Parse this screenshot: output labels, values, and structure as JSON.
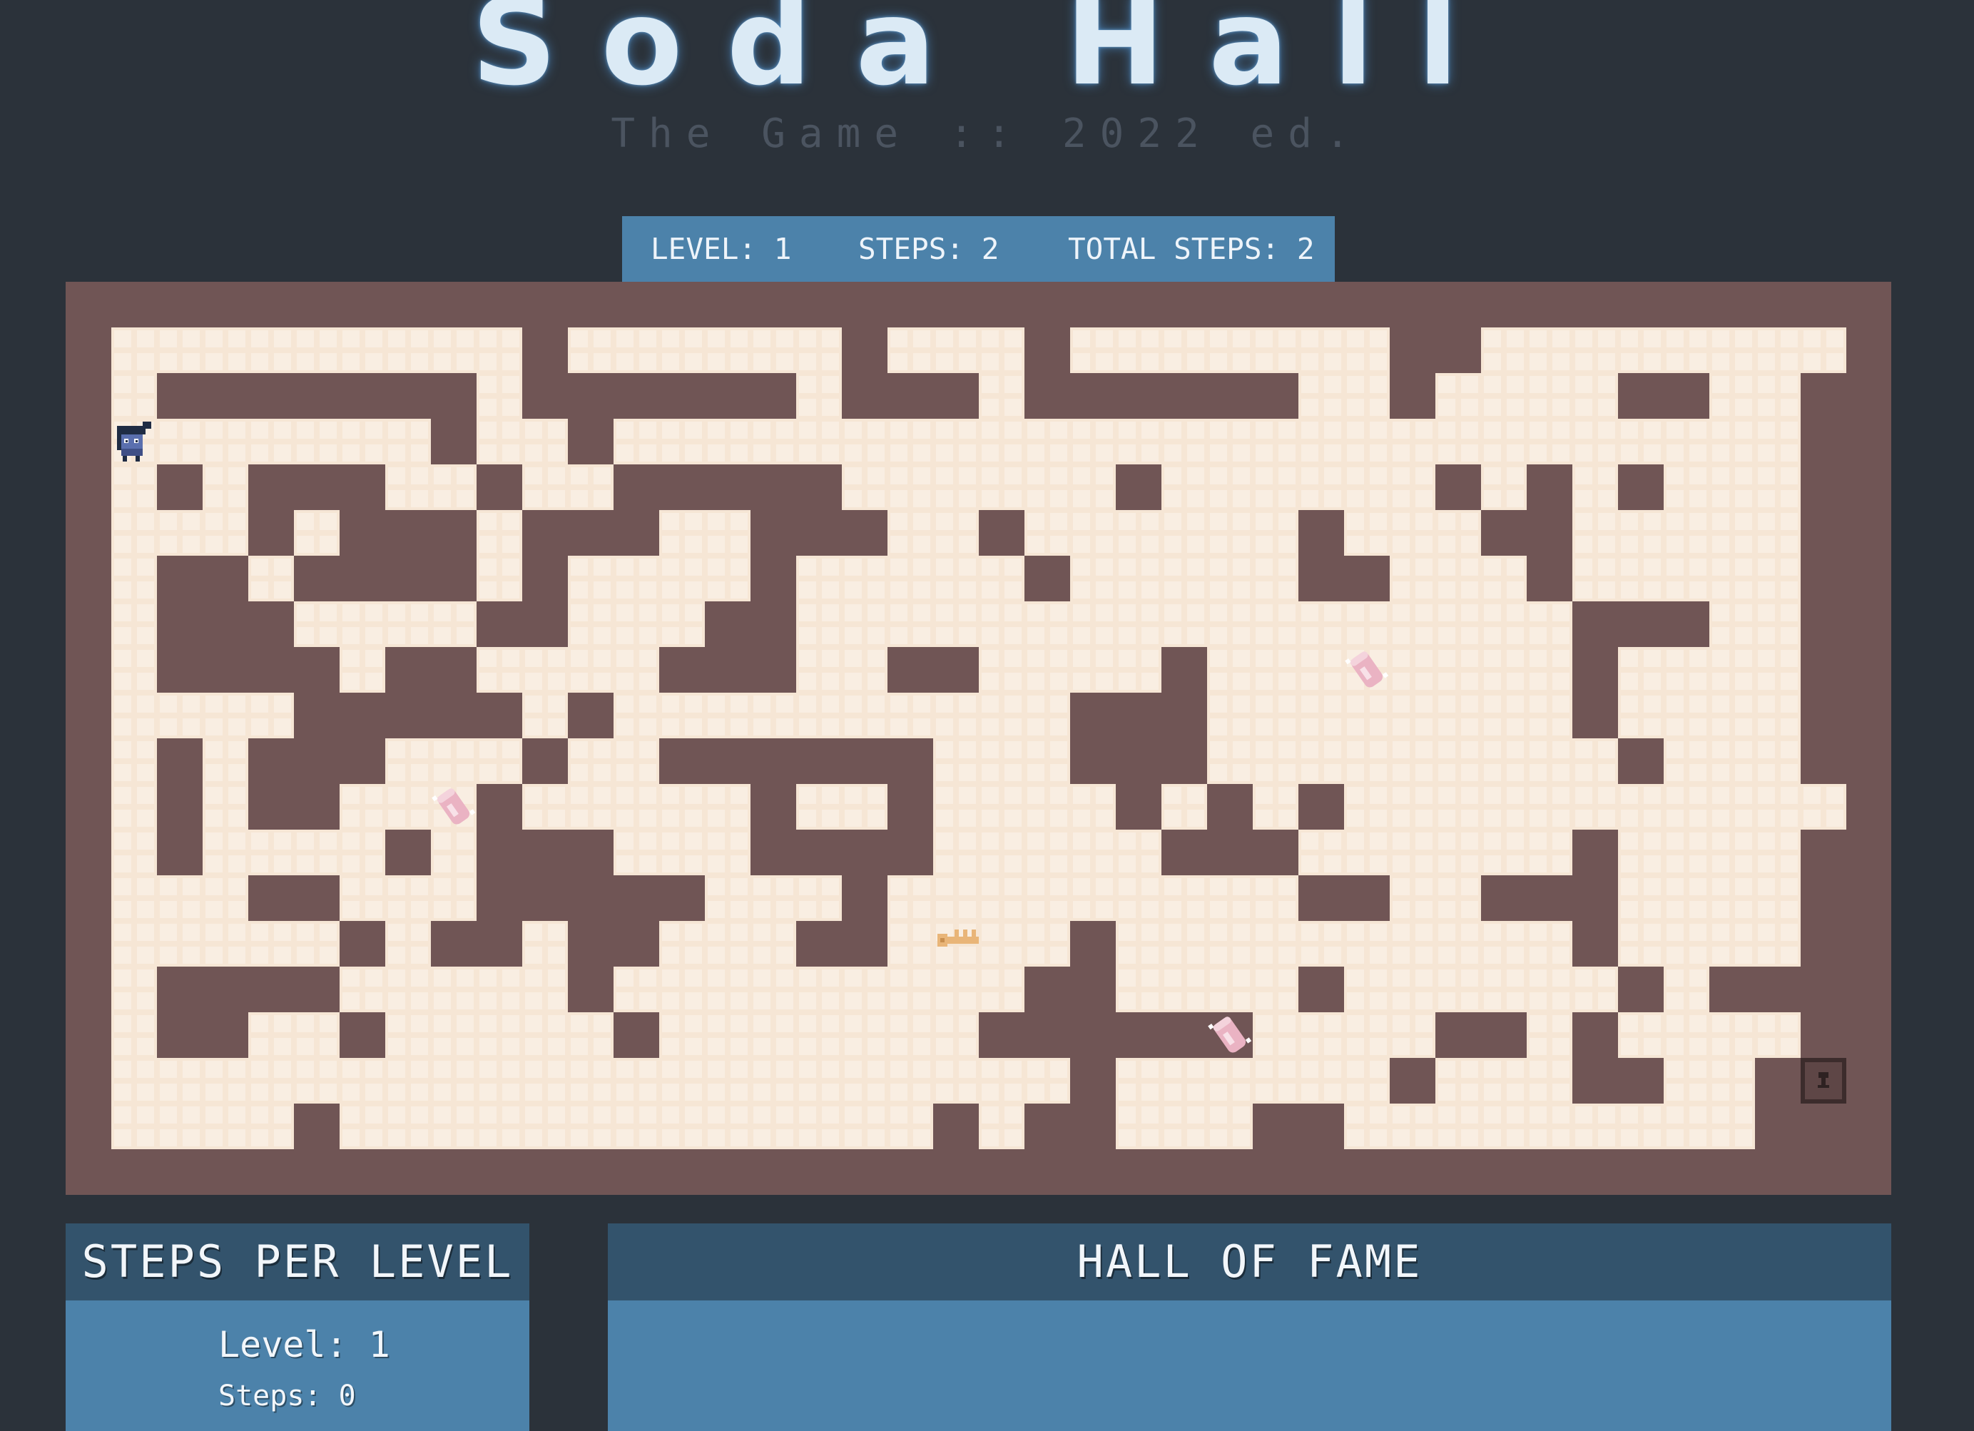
{
  "header": {
    "title": "Soda Hall",
    "subtitle": "The Game :: 2022 ed."
  },
  "status": {
    "level": "LEVEL: 1",
    "steps": "STEPS: 2",
    "total_steps": "TOTAL STEPS: 2"
  },
  "maze": {
    "cols": 38,
    "rows": 18,
    "colors": {
      "floor": "#f6e6d5",
      "floor_inner": "#f9eee2",
      "wall": "#705555"
    },
    "open": [
      "11111111101111110111011111110011111111",
      "10000000100000010001000000110111100110",
      "11111110110111111111111111111111111110",
      "10100011011000001111110111111010101110",
      "11101000100011000110111111011100111110",
      "10010000101111011111011111001110111110",
      "10001111001110011111111111111111000110",
      "10000100111100011001111011111111011110",
      "11110000010111111111100011111111011110",
      "10100011101100000011100011111111101110",
      "10100111011111011011110101011111111111",
      "10111101000111000011111000111111011110",
      "11100111000001110111111111001100011110",
      "11111010010011100111101111111111011110",
      "10000111110111111111001111011111101000",
      "10011011111011111110000001111001011110",
      "11111111111111111111101111110111001100",
      "11110111111111111101001110011111111100"
    ],
    "player": {
      "row": 2,
      "col": 0,
      "icon": "player-icon"
    },
    "key": {
      "row": 13,
      "col": 18,
      "icon": "key-icon"
    },
    "door": {
      "row": 16,
      "col": 37,
      "icon": "locked-door-icon"
    },
    "sodas": [
      {
        "row": 7,
        "col": 27,
        "icon": "soda-can-icon"
      },
      {
        "row": 10,
        "col": 7,
        "icon": "soda-can-icon"
      },
      {
        "row": 15,
        "col": 24,
        "icon": "soda-can-icon"
      }
    ]
  },
  "steps_panel": {
    "title": "STEPS PER LEVEL",
    "level_line": "Level: 1",
    "steps_line": "Steps: 0"
  },
  "hall_of_fame": {
    "title": "HALL OF FAME"
  }
}
